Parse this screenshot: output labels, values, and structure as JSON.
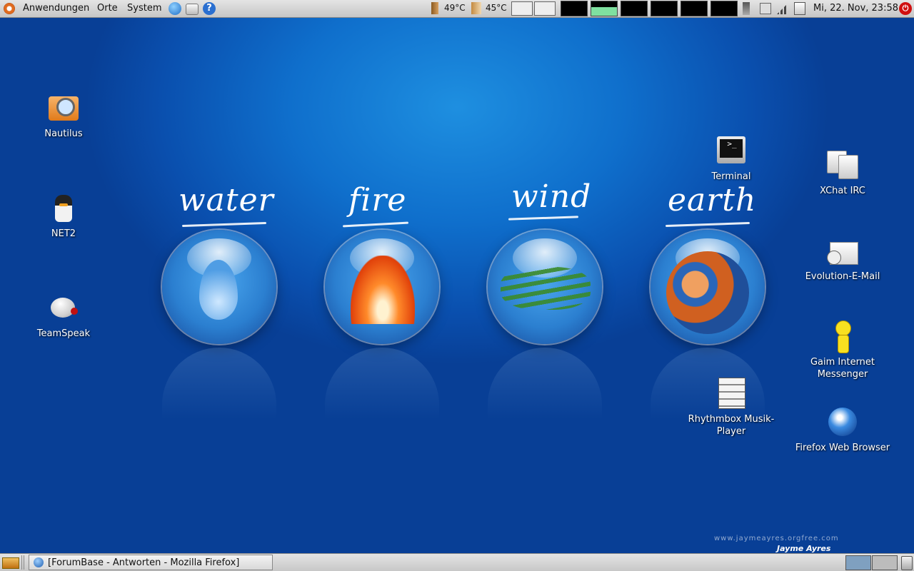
{
  "top_panel": {
    "menus": [
      "Anwendungen",
      "Orte",
      "System"
    ],
    "temps": [
      "49°C",
      "45°C"
    ],
    "clock": "Mi, 22. Nov, 23:58"
  },
  "desktop_left": [
    {
      "label": "Nautilus",
      "icon": "folder-search-icon"
    },
    {
      "label": "NET2",
      "icon": "net2-app-icon"
    },
    {
      "label": "TeamSpeak",
      "icon": "teamspeak-icon"
    }
  ],
  "desktop_right": [
    {
      "label": "Terminal",
      "icon": "terminal-icon"
    },
    {
      "label": "XChat IRC",
      "icon": "chat-bubbles-icon"
    },
    {
      "label": "Evolution-E-Mail",
      "icon": "mail-envelope-icon"
    },
    {
      "label": "Gaim Internet Messenger",
      "icon": "gaim-person-icon"
    },
    {
      "label": "Rhythmbox Musik-Player",
      "icon": "rhythmbox-stereo-icon"
    },
    {
      "label": "Firefox Web Browser",
      "icon": "globe-icon"
    }
  ],
  "wallpaper": {
    "elements": [
      "water",
      "fire",
      "wind",
      "earth"
    ],
    "watermark": "www.jaymeayres.orgfree.com",
    "brand": "Jayme Ayres"
  },
  "bottom_panel": {
    "task": "[ForumBase - Antworten - Mozilla Firefox]"
  },
  "colors": {
    "desktop": "#0f6fcc",
    "panel": "#d6d6d6"
  }
}
